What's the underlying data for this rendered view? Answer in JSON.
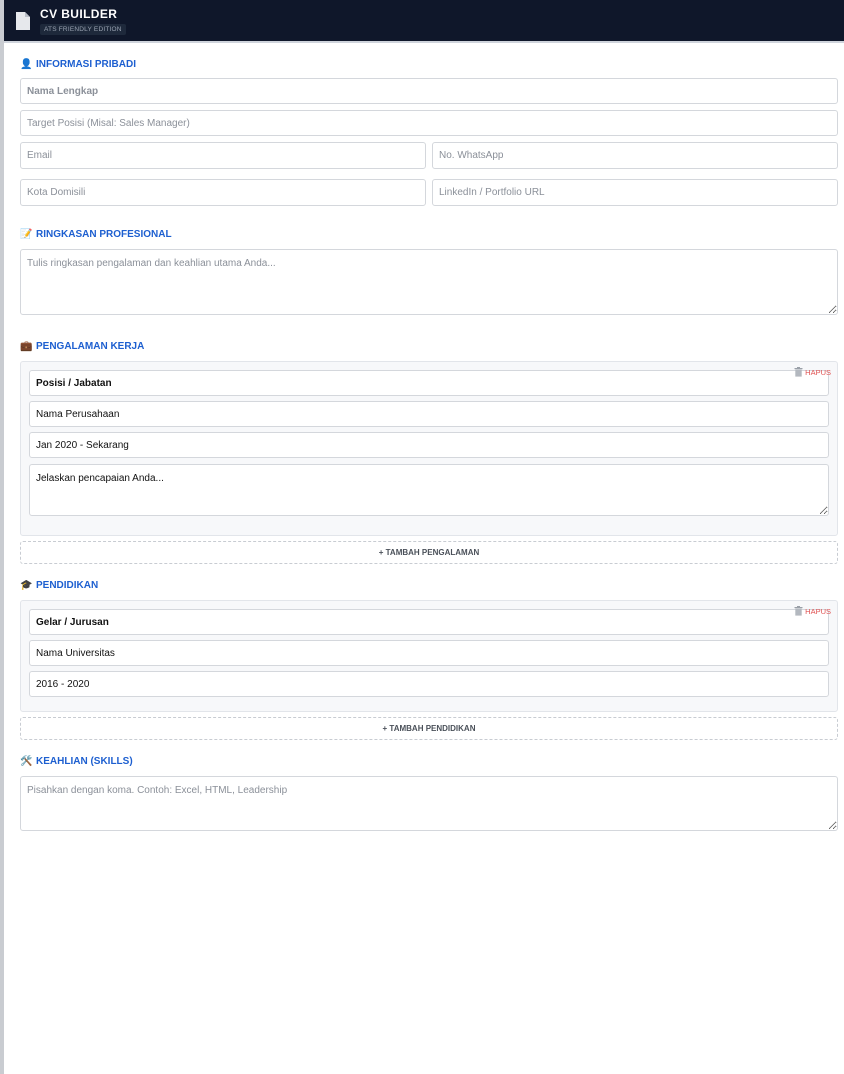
{
  "header": {
    "title": "CV BUILDER",
    "badge": "ATS FRIENDLY EDITION"
  },
  "personal": {
    "title": "INFORMASI PRIBADI",
    "icon": "👤",
    "name_placeholder": "Nama Lengkap",
    "position_placeholder": "Target Posisi (Misal: Sales Manager)",
    "email_placeholder": "Email",
    "whatsapp_placeholder": "No. WhatsApp",
    "city_placeholder": "Kota Domisili",
    "linkedin_placeholder": "LinkedIn / Portfolio URL"
  },
  "summary": {
    "title": "RINGKASAN PROFESIONAL",
    "icon": "📝",
    "placeholder": "Tulis ringkasan pengalaman dan keahlian utama Anda..."
  },
  "experience": {
    "title": "PENGALAMAN KERJA",
    "icon": "💼",
    "delete_label": "HAPUS",
    "position_value": "Posisi / Jabatan",
    "company_value": "Nama Perusahaan",
    "period_value": "Jan 2020 - Sekarang",
    "description_value": "Jelaskan pencapaian Anda...",
    "add_label": "+ TAMBAH PENGALAMAN"
  },
  "education": {
    "title": "PENDIDIKAN",
    "icon": "🎓",
    "delete_label": "HAPUS",
    "degree_value": "Gelar / Jurusan",
    "university_value": "Nama Universitas",
    "period_value": "2016 - 2020",
    "add_label": "+ TAMBAH PENDIDIKAN"
  },
  "skills": {
    "title": "KEAHLIAN (SKILLS)",
    "icon": "🛠️",
    "placeholder": "Pisahkan dengan koma. Contoh: Excel, HTML, Leadership"
  },
  "colors": {
    "header_bg": "#0f172a",
    "accent": "#1d5fd0",
    "danger": "#e05252"
  }
}
